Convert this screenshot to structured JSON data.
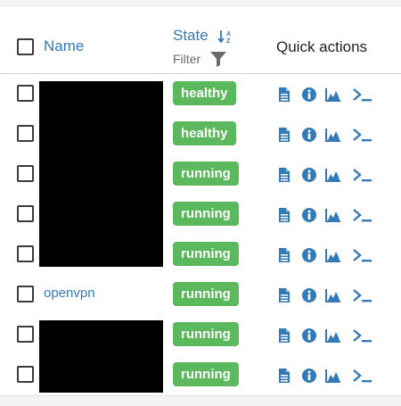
{
  "header": {
    "name_label": "Name",
    "state_label": "State",
    "filter_label": "Filter",
    "quick_actions_label": "Quick actions"
  },
  "colors": {
    "link": "#337ab7",
    "badge_green": "#5cb85c"
  },
  "icons": {
    "sort": "sort-alpha-icon",
    "filter": "filter-icon",
    "actions": [
      "logs-icon",
      "info-icon",
      "stats-icon",
      "console-icon"
    ]
  },
  "rows": [
    {
      "name": "",
      "state": "healthy"
    },
    {
      "name": "",
      "state": "healthy"
    },
    {
      "name": "",
      "state": "running"
    },
    {
      "name": "",
      "state": "running"
    },
    {
      "name": "",
      "state": "running"
    },
    {
      "name": "openvpn",
      "state": "running"
    },
    {
      "name": "",
      "state": "running"
    },
    {
      "name": "",
      "state": "running"
    }
  ]
}
